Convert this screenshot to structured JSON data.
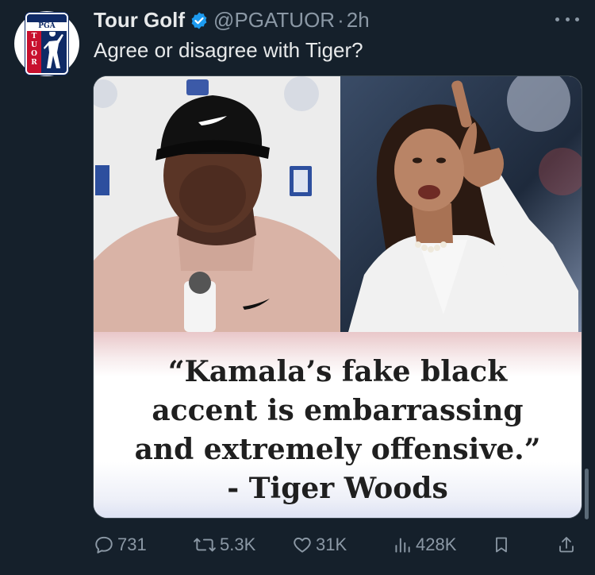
{
  "post": {
    "display_name": "Tour Golf",
    "handle": "@PGATUOR",
    "separator": "·",
    "time": "2h",
    "text": "Agree or disagree with Tiger?"
  },
  "avatar": {
    "logo_top_text": "PGA",
    "logo_side_text": [
      "T",
      "U",
      "O",
      "R"
    ]
  },
  "media": {
    "quote_lines": [
      "“Kamala’s fake black",
      "accent is embarrassing",
      "and extremely offensive.”",
      "- Tiger Woods"
    ]
  },
  "actions": {
    "replies": "731",
    "reposts": "5.3K",
    "likes": "31K",
    "views": "428K"
  },
  "colors": {
    "background": "#15202b",
    "muted": "#8b98a5",
    "verified": "#1d9bf0",
    "logo_blue": "#0f2a66",
    "logo_red": "#c8102e"
  }
}
